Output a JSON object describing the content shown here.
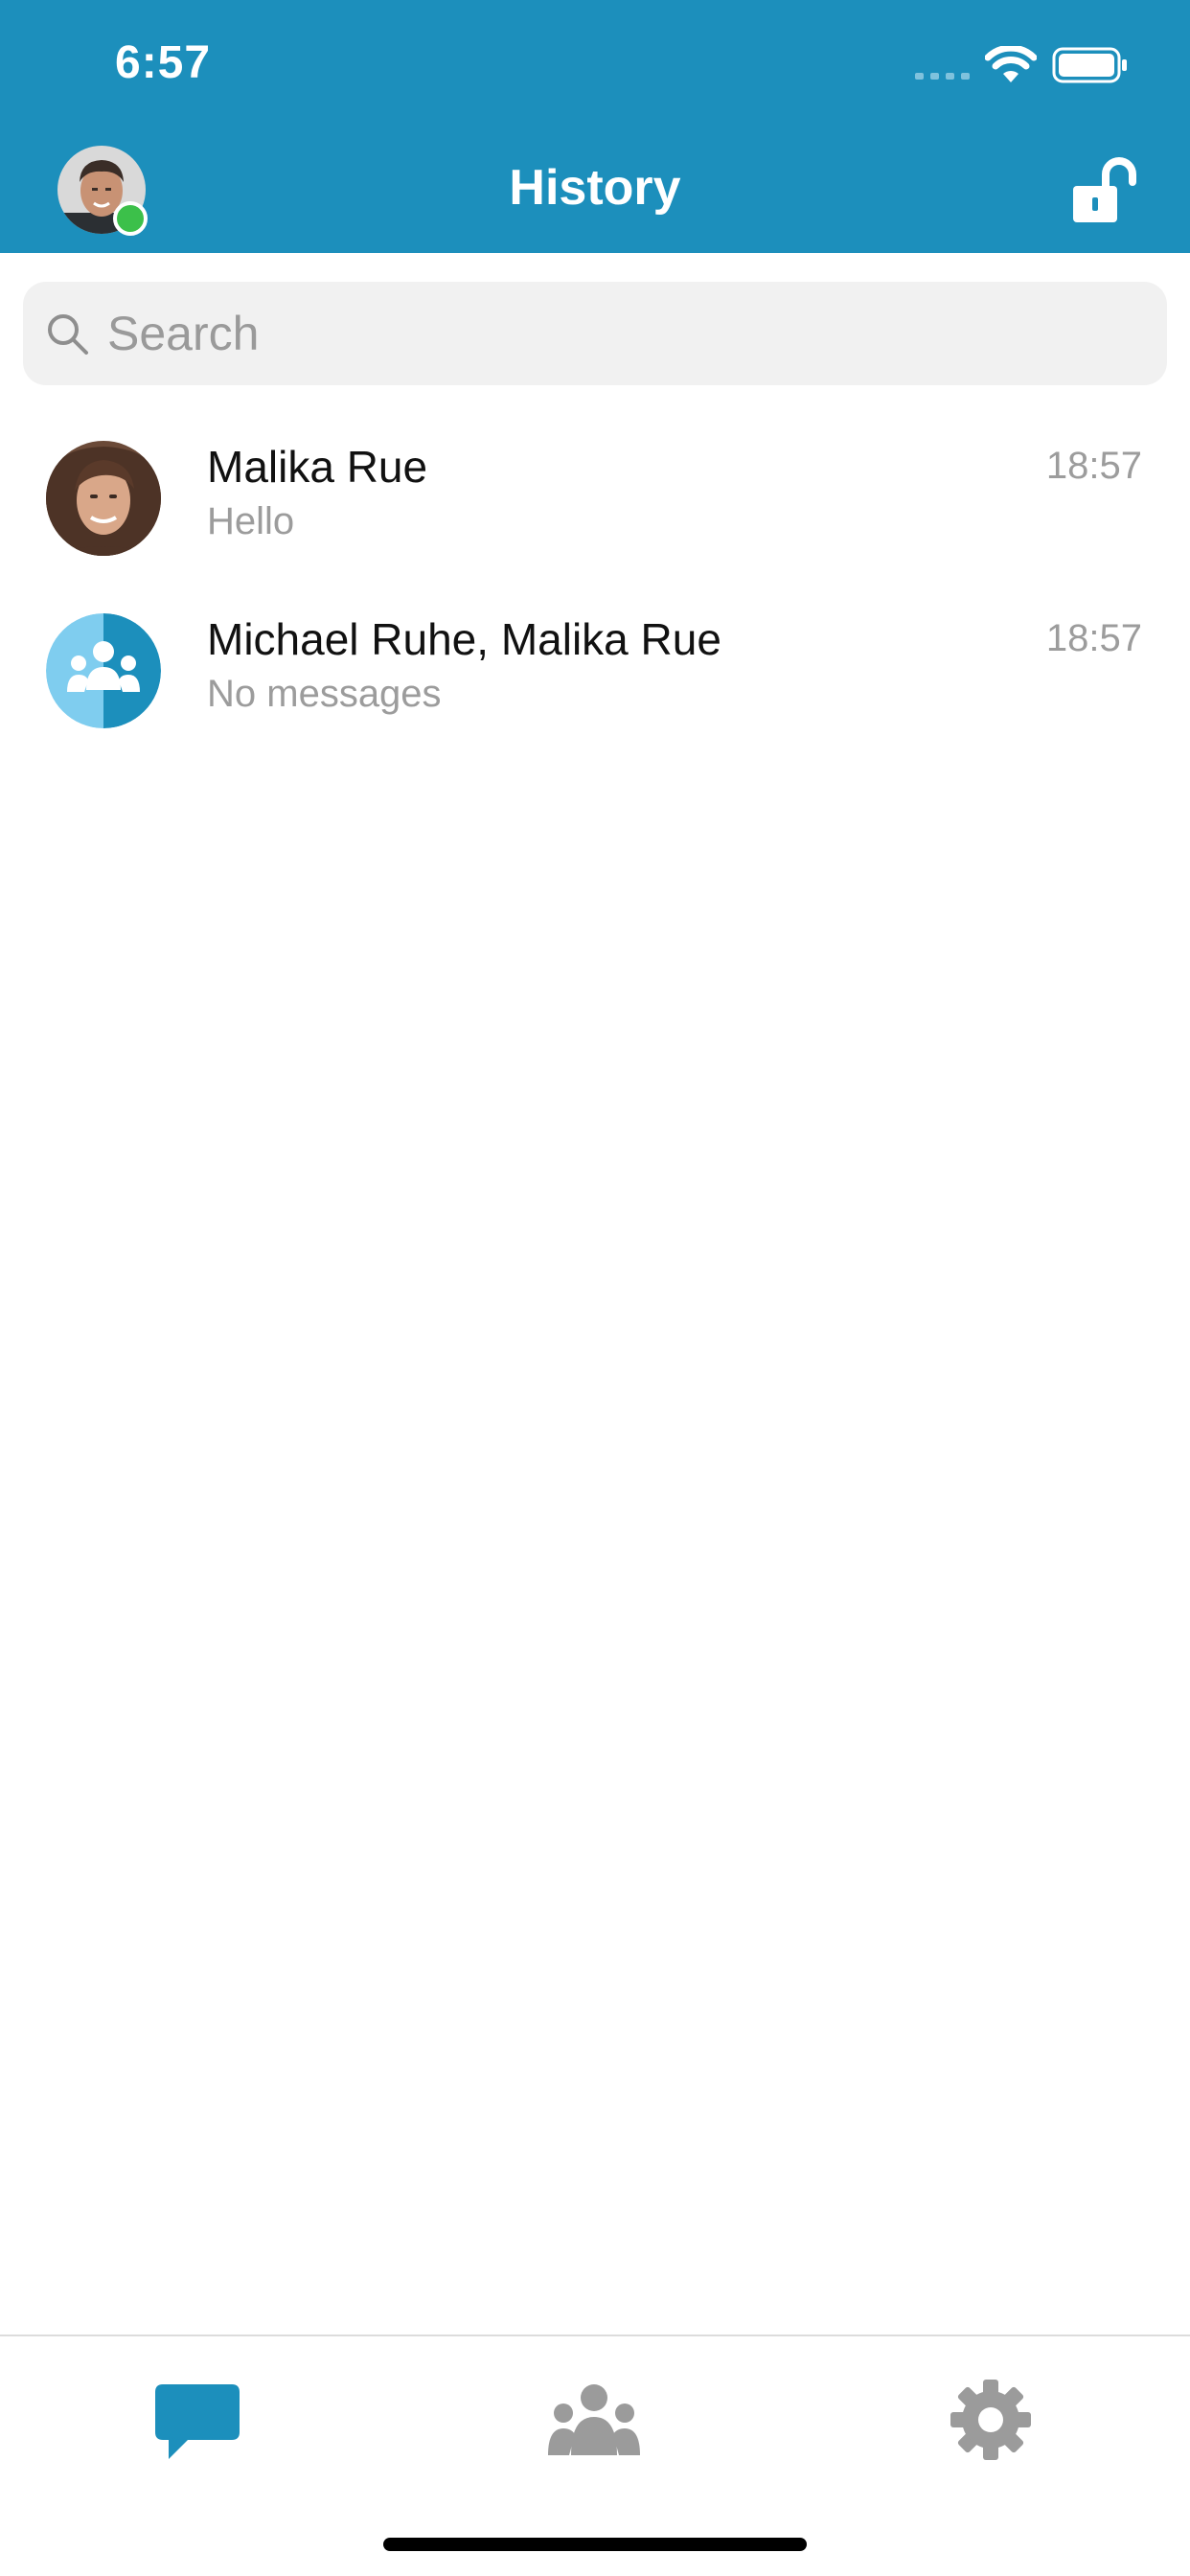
{
  "status_bar": {
    "time": "6:57"
  },
  "header": {
    "title": "History",
    "background_color": "#1c8fbc",
    "presence_color": "#3cc04a",
    "lock_icon": "unlocked-padlock-icon"
  },
  "search": {
    "placeholder": "Search",
    "value": ""
  },
  "conversations": [
    {
      "name": "Malika Rue",
      "preview": "Hello",
      "time": "18:57",
      "avatar": "person-photo"
    },
    {
      "name": "Michael Ruhe, Malika Rue",
      "preview": "No messages",
      "time": "18:57",
      "avatar": "group-icon"
    }
  ],
  "tab_bar": {
    "tabs": [
      {
        "id": "chats",
        "icon": "chat-bubble-icon",
        "active": true
      },
      {
        "id": "contacts",
        "icon": "people-icon",
        "active": false
      },
      {
        "id": "settings",
        "icon": "gear-icon",
        "active": false
      }
    ],
    "active_color": "#1c8fbc",
    "inactive_color": "#9b9b9b"
  }
}
